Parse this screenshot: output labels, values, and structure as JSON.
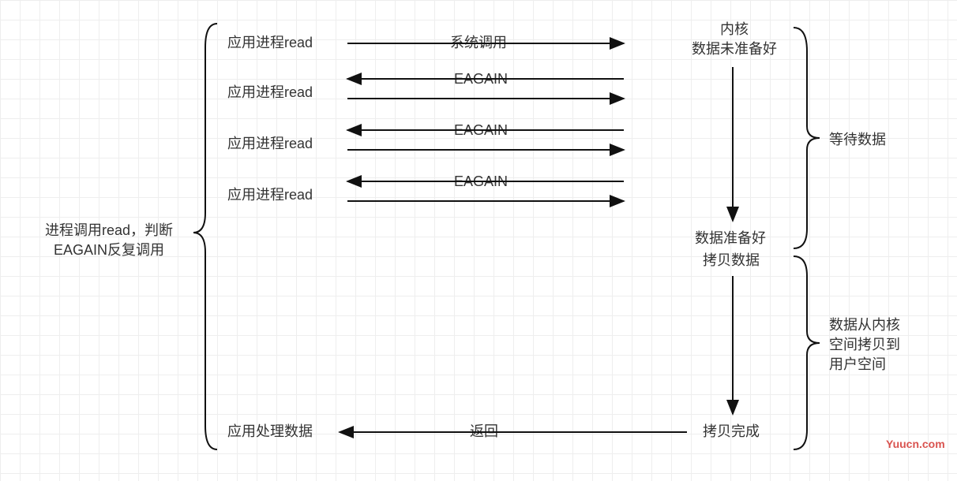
{
  "diagram": {
    "left_annotation": "进程调用read，判断\nEAGAIN反复调用",
    "read_calls": [
      {
        "label": "应用进程read",
        "arrow_label": "系统调用"
      },
      {
        "label": "应用进程read",
        "arrow_label": "EAGAIN"
      },
      {
        "label": "应用进程read",
        "arrow_label": "EAGAIN"
      },
      {
        "label": "应用进程read",
        "arrow_label": "EAGAIN"
      }
    ],
    "kernel_top": "内核\n数据未准备好",
    "kernel_ready": "数据准备好",
    "kernel_copy": "拷贝数据",
    "kernel_done": "拷贝完成",
    "app_done": "应用处理数据",
    "return_label": "返回",
    "right_annotation_top": "等待数据",
    "right_annotation_bottom": "数据从内核\n空间拷贝到\n用户空间",
    "watermark": "Yuucn.com"
  }
}
